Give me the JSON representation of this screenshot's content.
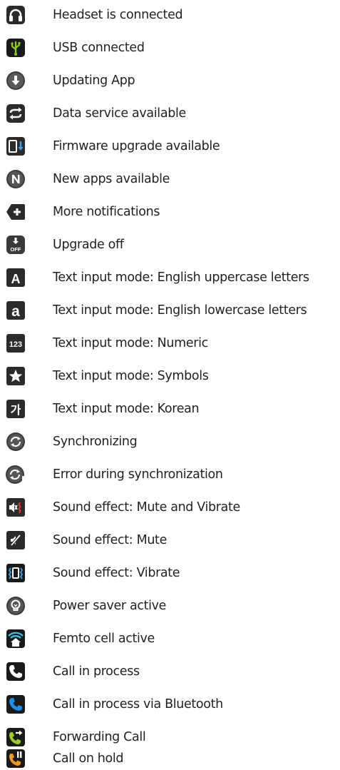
{
  "items": [
    {
      "label": "Headset is connected",
      "icon": "headset-icon"
    },
    {
      "label": "USB connected",
      "icon": "usb-icon"
    },
    {
      "label": "Updating App",
      "icon": "download-arrow-icon"
    },
    {
      "label": "Data service available",
      "icon": "sync-arrows-icon"
    },
    {
      "label": "Firmware upgrade available",
      "icon": "firmware-upgrade-icon"
    },
    {
      "label": "New apps available",
      "icon": "new-apps-icon"
    },
    {
      "label": "More notifications",
      "icon": "more-notifications-icon"
    },
    {
      "label": "Upgrade off",
      "icon": "upgrade-off-icon",
      "icon_text": "OFF"
    },
    {
      "label": "Text input mode: English uppercase letters",
      "icon": "uppercase-a-icon",
      "icon_text": "A"
    },
    {
      "label": "Text input mode: English lowercase letters",
      "icon": "lowercase-a-icon",
      "icon_text": "a"
    },
    {
      "label": "Text input mode: Numeric",
      "icon": "numeric-icon",
      "icon_text": "123"
    },
    {
      "label": "Text input mode: Symbols",
      "icon": "star-icon"
    },
    {
      "label": "Text input mode: Korean",
      "icon": "korean-icon",
      "icon_text": "가"
    },
    {
      "label": "Synchronizing",
      "icon": "sync-icon"
    },
    {
      "label": "Error during synchronization",
      "icon": "sync-error-icon"
    },
    {
      "label": "Sound effect: Mute and Vibrate",
      "icon": "mute-vibrate-icon"
    },
    {
      "label": "Sound effect: Mute",
      "icon": "mute-icon"
    },
    {
      "label": "Sound effect: Vibrate",
      "icon": "vibrate-icon"
    },
    {
      "label": "Power saver active",
      "icon": "power-saver-icon"
    },
    {
      "label": "Femto cell active",
      "icon": "femto-cell-icon"
    },
    {
      "label": "Call in process",
      "icon": "call-icon"
    },
    {
      "label": "Call in process via Bluetooth",
      "icon": "call-bluetooth-icon"
    },
    {
      "label": "Forwarding Call",
      "icon": "forwarding-call-icon"
    },
    {
      "label": "Call on hold",
      "icon": "call-hold-icon"
    }
  ],
  "colors": {
    "text": "#231f20",
    "icon_dark": "#2b2b2b",
    "usb_green": "#8cd600",
    "femto_cyan": "#36c8f0",
    "bluetooth_blue": "#1c8ee8",
    "call_green": "#9ad01c",
    "call_orange": "#f29b1b",
    "red": "#e03a3a"
  }
}
